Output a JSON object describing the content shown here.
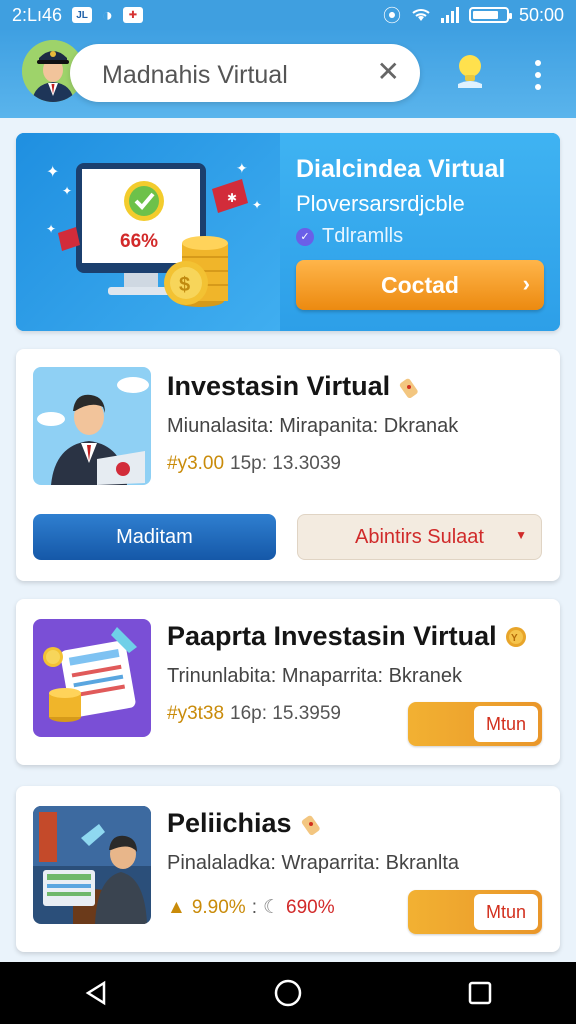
{
  "status_bar": {
    "time": "2:Lı46",
    "battery_text": "50:00",
    "battery_level": 0.78
  },
  "header": {
    "search_text": "Madnahis Virtual"
  },
  "hero": {
    "percent_text": "66%",
    "title": "Dialcindea Virtual",
    "subtitle": "Ploversarsrdjcble",
    "tag": "Tdlramlls",
    "button_label": "Coctad"
  },
  "cards": [
    {
      "title": "Investasin Virtual",
      "description": "Miunalasita: Mirapanita: Dkranak",
      "stat_primary": "#y3.00",
      "stat_secondary": "15p: 13.3039",
      "primary_button": "Maditam",
      "secondary_button": "Abintirs Sulaat"
    },
    {
      "title": "Paaprta Investasin Virtual",
      "description": "Trinunlabita: Mnaparrita: Bkranek",
      "stat_primary": "#y3t38",
      "stat_secondary": "16p: 15.3959",
      "button": "Mtun"
    },
    {
      "title": "Peliichias",
      "description": "Pinalaladka: Wraparrita: Bkranlta",
      "stat_primary": "9.90%",
      "stat_separator": ":",
      "stat_secondary": "690%",
      "button": "Mtun"
    }
  ],
  "colors": {
    "accent": "#3f9fe0",
    "orange": "#ec8a10",
    "gold": "#e9962a",
    "navy_button": "#1558a8",
    "red_text": "#d02a2a"
  }
}
